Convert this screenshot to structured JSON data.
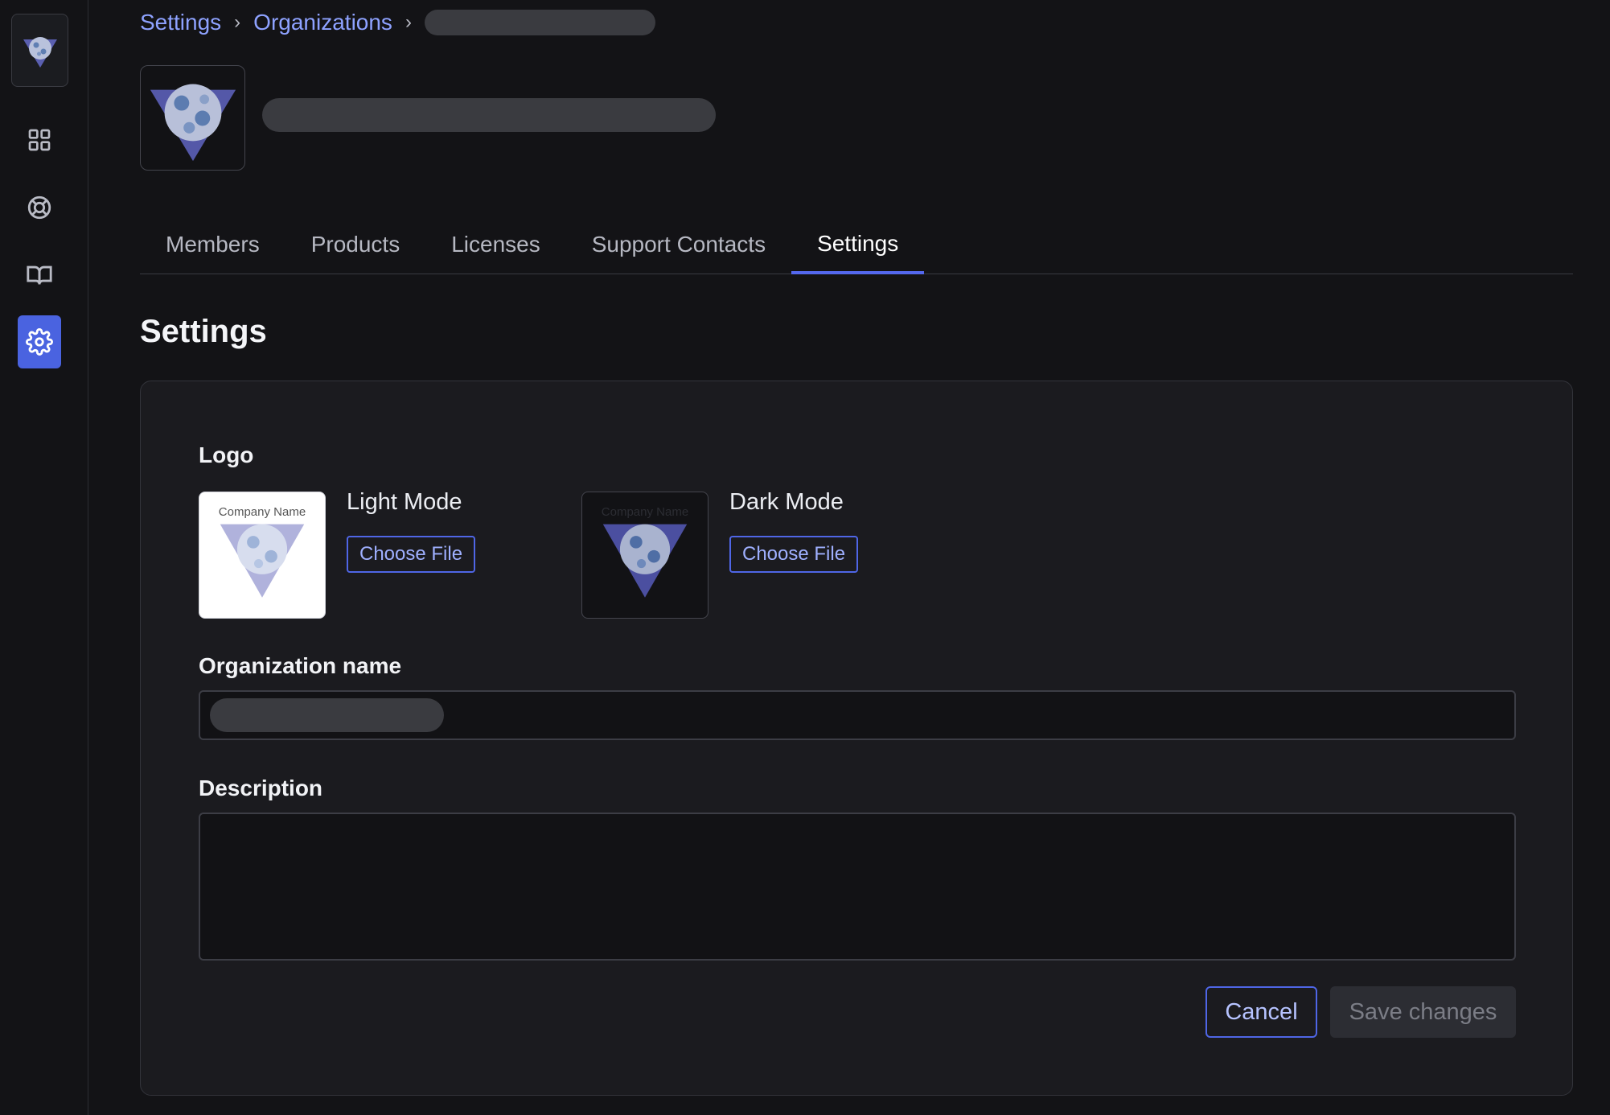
{
  "sidebar": {
    "items": [
      {
        "icon": "grid-icon",
        "label": "Dashboard"
      },
      {
        "icon": "lifebuoy-icon",
        "label": "Support"
      },
      {
        "icon": "book-icon",
        "label": "Docs"
      },
      {
        "icon": "gear-icon",
        "label": "Settings",
        "active": true
      }
    ]
  },
  "breadcrumb": {
    "items": [
      "Settings",
      "Organizations"
    ]
  },
  "tabs": [
    {
      "label": "Members"
    },
    {
      "label": "Products"
    },
    {
      "label": "Licenses"
    },
    {
      "label": "Support Contacts"
    },
    {
      "label": "Settings",
      "active": true
    }
  ],
  "page": {
    "title": "Settings"
  },
  "form": {
    "logo_label": "Logo",
    "light": {
      "caption": "Company Name",
      "mode_label": "Light Mode",
      "button": "Choose File"
    },
    "dark": {
      "caption": "Company Name",
      "mode_label": "Dark Mode",
      "button": "Choose File"
    },
    "org_name_label": "Organization name",
    "description_label": "Description",
    "description_value": "",
    "cancel": "Cancel",
    "save": "Save changes"
  },
  "colors": {
    "background": "#131316",
    "accent": "#4a63e0",
    "link": "#8ea2ff",
    "card": "#1b1b1f"
  }
}
